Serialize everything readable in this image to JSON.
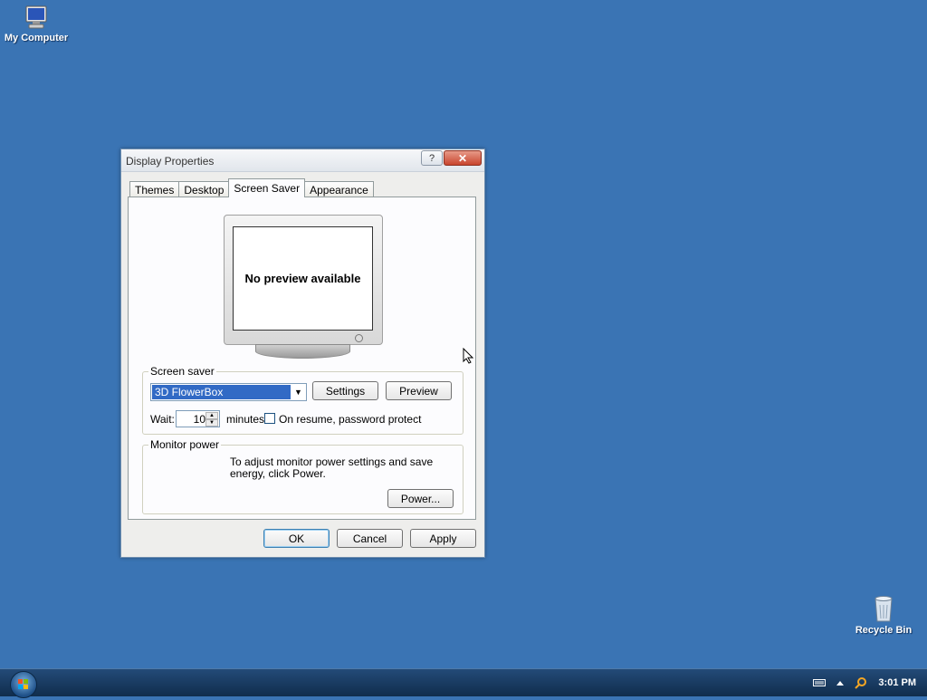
{
  "desktop": {
    "icons": [
      {
        "label": "My Computer",
        "icon": "my-computer-icon"
      },
      {
        "label": "Recycle Bin",
        "icon": "recycle-bin-icon"
      }
    ]
  },
  "dialog": {
    "title": "Display Properties",
    "help_label": "?",
    "close_label": "✕",
    "tabs": [
      {
        "label": "Themes",
        "active": false
      },
      {
        "label": "Desktop",
        "active": false
      },
      {
        "label": "Screen Saver",
        "active": true
      },
      {
        "label": "Appearance",
        "active": false
      }
    ],
    "preview_text": "No preview available",
    "screen_saver": {
      "group_label": "Screen saver",
      "selected": "3D FlowerBox",
      "settings_label": "Settings",
      "preview_label": "Preview",
      "wait_label": "Wait:",
      "wait_value": "10",
      "minutes_label": "minutes",
      "password_label": "On resume, password protect",
      "password_checked": false
    },
    "monitor_power": {
      "group_label": "Monitor power",
      "description": "To adjust monitor power settings and save energy, click Power.",
      "power_label": "Power..."
    },
    "buttons": {
      "ok": "OK",
      "cancel": "Cancel",
      "apply": "Apply"
    }
  },
  "taskbar": {
    "clock": "3:01 PM"
  },
  "colors": {
    "desktop": "#3a74b4",
    "selection": "#316ac5",
    "close": "#c8452e"
  }
}
